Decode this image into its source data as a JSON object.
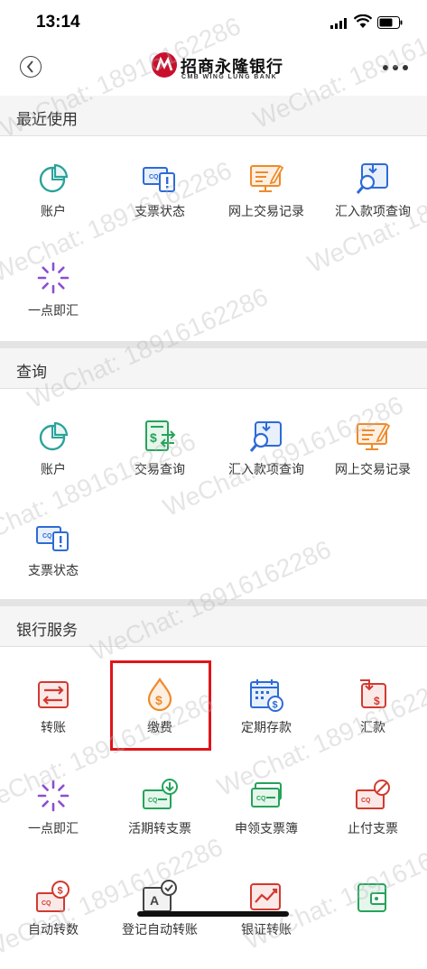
{
  "status": {
    "time": "13:14"
  },
  "header": {
    "logo_cn": "招商永隆银行",
    "logo_en": "CMB WING LUNG BANK"
  },
  "sections": {
    "recent": {
      "title": "最近使用",
      "items": [
        {
          "label": "账户",
          "icon": "pie-chart-icon"
        },
        {
          "label": "支票状态",
          "icon": "cheque-status-icon"
        },
        {
          "label": "网上交易记录",
          "icon": "monitor-edit-icon"
        },
        {
          "label": "汇入款项查询",
          "icon": "inward-remittance-search-icon"
        },
        {
          "label": "一点即汇",
          "icon": "loading-spinner-icon"
        }
      ]
    },
    "query": {
      "title": "查询",
      "items": [
        {
          "label": "账户",
          "icon": "pie-chart-icon"
        },
        {
          "label": "交易查询",
          "icon": "transaction-query-icon"
        },
        {
          "label": "汇入款项查询",
          "icon": "inward-remittance-search-icon"
        },
        {
          "label": "网上交易记录",
          "icon": "monitor-edit-icon"
        },
        {
          "label": "支票状态",
          "icon": "cheque-status-icon"
        }
      ]
    },
    "services": {
      "title": "银行服务",
      "items": [
        {
          "label": "转账",
          "icon": "transfer-icon"
        },
        {
          "label": "缴费",
          "icon": "bill-payment-icon"
        },
        {
          "label": "定期存款",
          "icon": "calendar-deposit-icon"
        },
        {
          "label": "汇款",
          "icon": "remittance-icon"
        },
        {
          "label": "一点即汇",
          "icon": "loading-spinner-icon"
        },
        {
          "label": "活期转支票",
          "icon": "savings-to-cheque-icon"
        },
        {
          "label": "申领支票簿",
          "icon": "chequebook-request-icon"
        },
        {
          "label": "止付支票",
          "icon": "stop-cheque-icon"
        },
        {
          "label": "自动转数",
          "icon": "auto-transfer-icon"
        },
        {
          "label": "登记自动转账",
          "icon": "register-auto-transfer-icon"
        },
        {
          "label": "银证转账",
          "icon": "securities-transfer-icon"
        },
        {
          "label": "",
          "icon": "wallet-icon"
        }
      ]
    }
  },
  "watermark": "WeChat: 18916162286",
  "colors": {
    "teal": "#2aa39a",
    "blue": "#2d6bd6",
    "orange": "#ef8a2a",
    "purple": "#8b4fd1",
    "green": "#26a35a",
    "red": "#d23a2f",
    "highlight": "#e0141a"
  }
}
